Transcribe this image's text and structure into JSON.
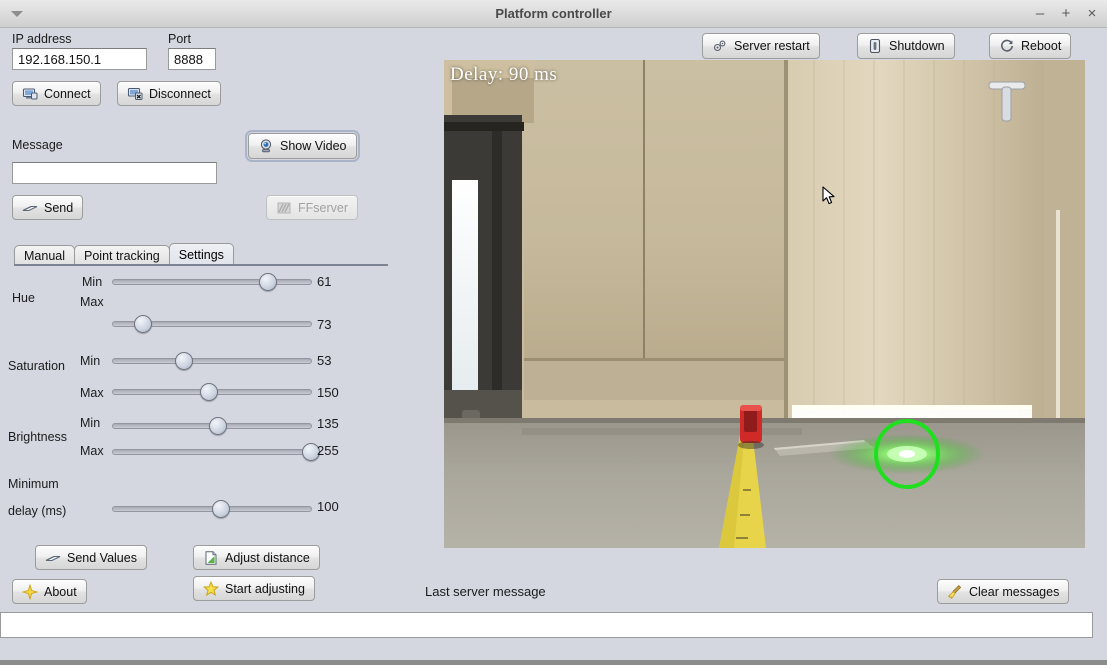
{
  "window": {
    "title": "Platform controller",
    "menu_icon": "caret-down-icon",
    "minimize": "–",
    "maximize": "+",
    "close": "×"
  },
  "connection": {
    "ip_label": "IP address",
    "ip_value": "192.168.150.1",
    "port_label": "Port",
    "port_value": "8888",
    "connect_label": "Connect",
    "disconnect_label": "Disconnect"
  },
  "message": {
    "label": "Message",
    "value": "",
    "placeholder": "",
    "send_label": "Send",
    "show_video_label": "Show Video",
    "ffserver_label": "FFserver"
  },
  "tabs": [
    {
      "label": "Manual",
      "active": false
    },
    {
      "label": "Point tracking",
      "active": false
    },
    {
      "label": "Settings",
      "active": true
    }
  ],
  "settings": {
    "groups": [
      {
        "name": "Hue",
        "rows": [
          {
            "sub": "Min",
            "value": "61",
            "percent": 82
          },
          {
            "sub": "Max",
            "value": "73",
            "percent": 13
          }
        ]
      },
      {
        "name": "Saturation",
        "rows": [
          {
            "sub": "Min",
            "value": "53",
            "percent": 37
          },
          {
            "sub": "Max",
            "value": "150",
            "percent": 48
          }
        ]
      },
      {
        "name": "Brightness",
        "rows": [
          {
            "sub": "Min",
            "value": "135",
            "percent": 53
          },
          {
            "sub": "Max",
            "value": "255",
            "percent": 97
          }
        ]
      }
    ],
    "delay": {
      "name_line1": "Minimum",
      "name_line2": "delay (ms)",
      "value": "100",
      "percent": 55
    }
  },
  "actions": {
    "send_values_label": "Send Values",
    "adjust_distance_label": "Adjust distance",
    "about_label": "About",
    "start_adjusting_label": "Start adjusting"
  },
  "server": {
    "restart_label": "Server restart",
    "shutdown_label": "Shutdown",
    "reboot_label": "Reboot"
  },
  "status": {
    "last_message_label": "Last server message",
    "clear_label": "Clear messages",
    "message_value": ""
  },
  "video": {
    "delay_overlay": "Delay: 90 ms",
    "tracking_marker": "green-circle-marker",
    "scene": "corridor with wooden doors, yellow tape measure, red laser device, green laser dot"
  },
  "colors": {
    "panel": "#d4d7e0",
    "titlebar": "#dcdcdc",
    "tracking_marker": "#22dd22",
    "focus_ring": "#a9b4c9"
  }
}
